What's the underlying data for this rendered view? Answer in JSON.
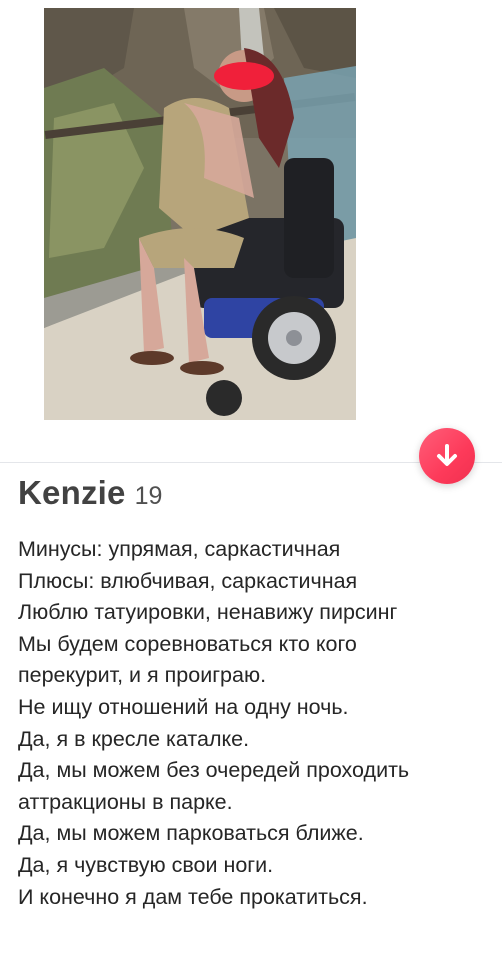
{
  "profile": {
    "name": "Kenzie",
    "age": "19",
    "bio_lines": [
      "Минусы: упрямая, саркастичная",
      "Плюсы: влюбчивая, саркастичная",
      "Люблю татуировки, ненавижу пирсинг",
      "Мы будем соревноваться кто кого",
      "перекурит, и я проиграю.",
      "Не ищу отношений на одну ночь.",
      "Да, я в кресле каталке.",
      "Да, мы можем без очередей проходить",
      "аттракционы в парке.",
      "Да, мы можем парковаться ближе.",
      "Да, я чувствую свои ноги.",
      "И конечно я дам тебе прокатиться."
    ]
  },
  "icons": {
    "collapse_button": "arrow-down-icon"
  },
  "colors": {
    "accent": "#fd3a5a",
    "name_text": "#424242",
    "body_text": "#262626"
  }
}
